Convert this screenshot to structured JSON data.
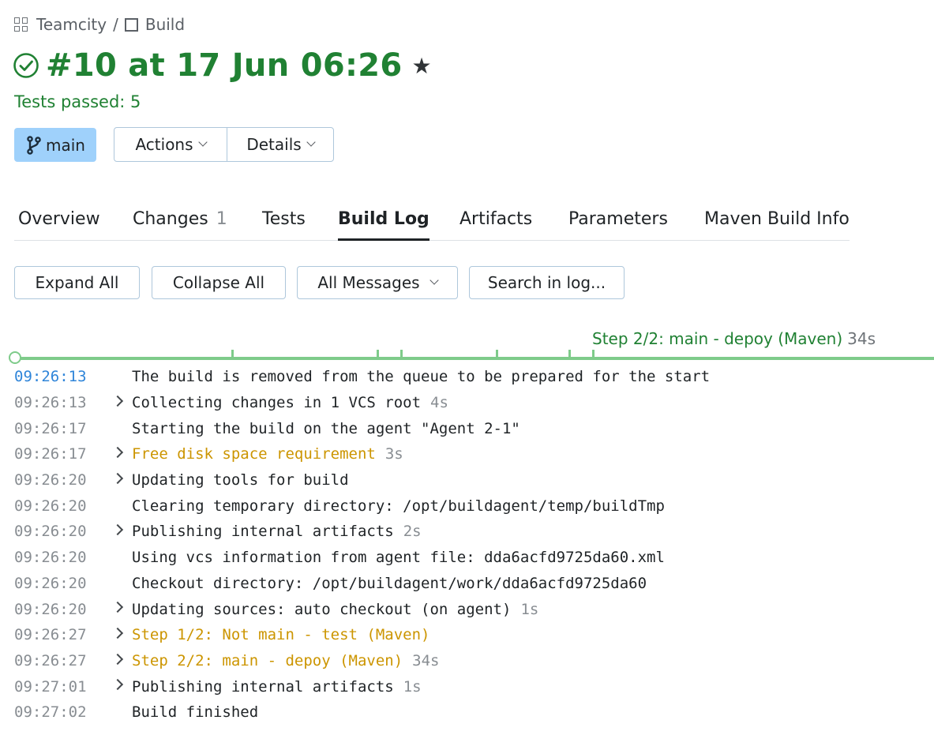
{
  "breadcrumb": {
    "project": "Teamcity",
    "separator": "/",
    "build_config": "Build"
  },
  "build": {
    "title": "#10 at 17 Jun 06:26",
    "status": "Tests passed: 5",
    "status_color": "#208133"
  },
  "branch": {
    "label": "main"
  },
  "buttons": {
    "actions": "Actions",
    "details": "Details"
  },
  "tabs": [
    {
      "label": "Overview"
    },
    {
      "label": "Changes",
      "count": "1"
    },
    {
      "label": "Tests"
    },
    {
      "label": "Build Log",
      "active": true
    },
    {
      "label": "Artifacts"
    },
    {
      "label": "Parameters"
    },
    {
      "label": "Maven Build Info"
    }
  ],
  "toolbar": {
    "expand_all": "Expand All",
    "collapse_all": "Collapse All",
    "filter": "All Messages",
    "search": "Search in log..."
  },
  "timeline": {
    "step_label": "Step 2/2: main - depoy (Maven)",
    "step_duration": "34s"
  },
  "log": [
    {
      "time": "09:26:13",
      "text": "The build is removed from the queue to be prepared for the start",
      "expandable": false
    },
    {
      "time": "09:26:13",
      "text": "Collecting changes in 1 VCS root",
      "duration": "4s",
      "expandable": true
    },
    {
      "time": "09:26:17",
      "text": "Starting the build on the agent \"Agent 2-1\"",
      "expandable": false
    },
    {
      "time": "09:26:17",
      "text": "Free disk space requirement",
      "duration": "3s",
      "expandable": true,
      "warning": true
    },
    {
      "time": "09:26:20",
      "text": "Updating tools for build",
      "expandable": true
    },
    {
      "time": "09:26:20",
      "text": "Clearing temporary directory: /opt/buildagent/temp/buildTmp",
      "expandable": false
    },
    {
      "time": "09:26:20",
      "text": "Publishing internal artifacts",
      "duration": "2s",
      "expandable": true
    },
    {
      "time": "09:26:20",
      "text": "Using vcs information from agent file: dda6acfd9725da60.xml",
      "expandable": false
    },
    {
      "time": "09:26:20",
      "text": "Checkout directory: /opt/buildagent/work/dda6acfd9725da60",
      "expandable": false
    },
    {
      "time": "09:26:20",
      "text": "Updating sources: auto checkout (on agent)",
      "duration": "1s",
      "expandable": true
    },
    {
      "time": "09:26:27",
      "text": "Step 1/2: Not main - test (Maven)",
      "expandable": true,
      "warning": true
    },
    {
      "time": "09:26:27",
      "text": "Step 2/2: main - depoy (Maven)",
      "duration": "34s",
      "expandable": true,
      "warning": true
    },
    {
      "time": "09:27:01",
      "text": "Publishing internal artifacts",
      "duration": "1s",
      "expandable": true
    },
    {
      "time": "09:27:02",
      "text": "Build finished",
      "expandable": false
    }
  ],
  "colors": {
    "success": "#208133",
    "warning": "#cc9500",
    "accent": "#2f85d9",
    "branch_bg": "#9fd1fb",
    "timeline": "#7ecb8a"
  }
}
